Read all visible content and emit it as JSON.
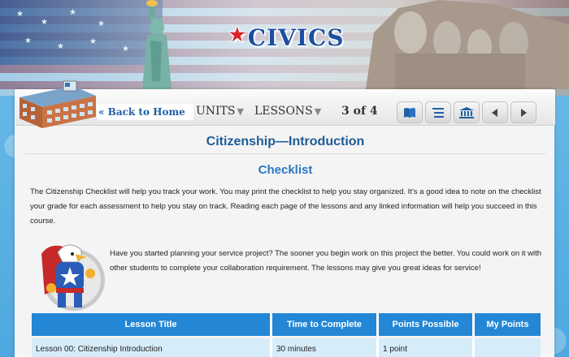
{
  "header": {
    "logo_text": "CIVICS"
  },
  "nav": {
    "back_label": "« Back to Home",
    "units_label": "UNITS",
    "lessons_label": "LESSONS",
    "page_indicator": "3 of 4",
    "buttons": [
      {
        "icon": "book-icon"
      },
      {
        "icon": "list-icon"
      },
      {
        "icon": "building-columns-icon"
      },
      {
        "icon": "previous-arrow-icon"
      },
      {
        "icon": "next-arrow-icon"
      }
    ]
  },
  "content": {
    "page_title": "Citizenship—Introduction",
    "section_title": "Checklist",
    "intro_text": "The Citizenship Checklist will help you track your work. You may print the checklist to help you stay organized. It's a good idea to note on the checklist your grade for each assessment to help you stay on track. Reading each page of the lessons and any linked information will help you succeed in this course.",
    "mascot_text": "Have you started planning your service project? The sooner you begin work on this project the better. You could work on it with other students to complete your collaboration requirement. The lessons may give you great ideas for service!"
  },
  "table": {
    "headers": [
      "Lesson Title",
      "Time to Complete",
      "Points Possible",
      "My Points"
    ],
    "rows": [
      [
        "Lesson 00: Citizenship Introduction",
        "30 minutes",
        "1 point",
        ""
      ]
    ]
  },
  "colors": {
    "header_blue": "#2387d6",
    "cell_blue": "#d6ecf8",
    "title_blue": "#1d5c97",
    "link_blue": "#1e5ea8",
    "logo_star_red": "#d9242a"
  }
}
